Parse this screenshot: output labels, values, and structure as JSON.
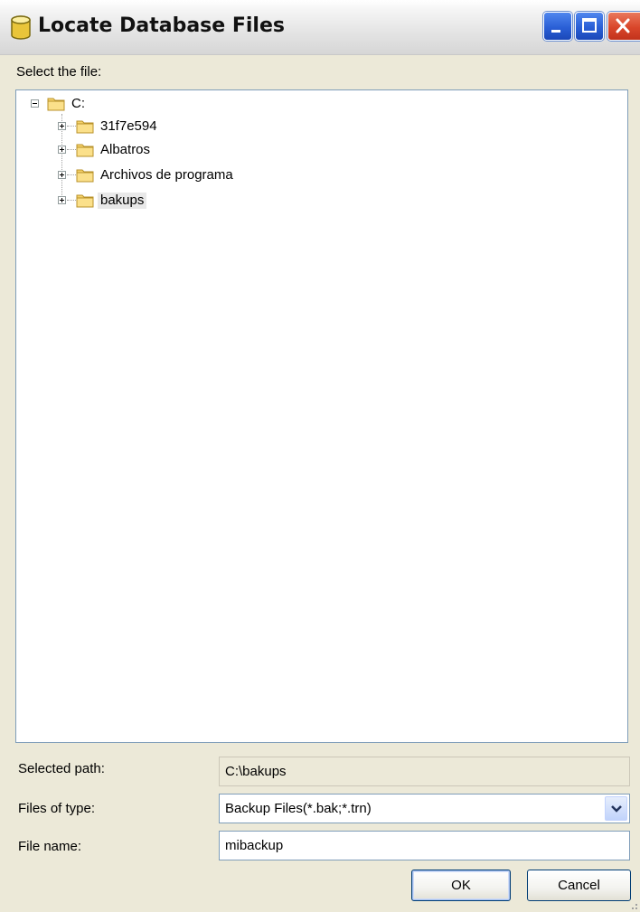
{
  "window": {
    "title": "Locate Database Files",
    "icon": "database-cylinder-icon",
    "controls": [
      "minimize-icon",
      "maximize-icon",
      "close-icon"
    ]
  },
  "tree": {
    "label": "Select the file:",
    "root": {
      "label": "C:",
      "expanded": true,
      "children": [
        {
          "label": "31f7e594",
          "expanded": false
        },
        {
          "label": "Albatros",
          "expanded": false
        },
        {
          "label": "Archivos de programa",
          "expanded": false
        },
        {
          "label": "bakups",
          "expanded": false,
          "selected": true
        }
      ]
    }
  },
  "fields": {
    "selected_path": {
      "label": "Selected path:",
      "value": "C:\\bakups"
    },
    "files_of_type": {
      "label": "Files of type:",
      "value": "Backup Files(*.bak;*.trn)"
    },
    "file_name": {
      "label": "File name:",
      "value": "mibackup"
    }
  },
  "buttons": {
    "ok": "OK",
    "cancel": "Cancel"
  },
  "colors": {
    "dialog_bg": "#ece9d8",
    "field_border": "#7f9db9",
    "folder_yellow": "#f6d26a"
  }
}
